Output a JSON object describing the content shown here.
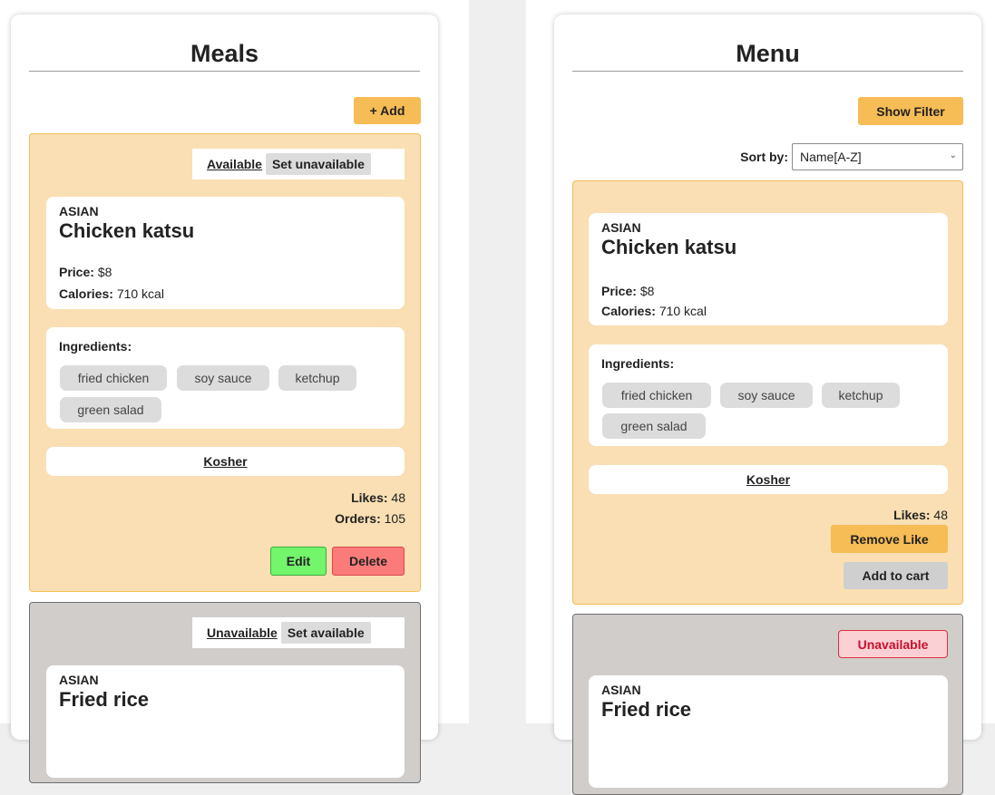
{
  "left": {
    "title": "Meals",
    "add_label": "+ Add",
    "meal1": {
      "status": "Available",
      "toggle_label": "Set unavailable",
      "cuisine": "ASIAN",
      "name": "Chicken katsu",
      "price_label": "Price:",
      "price": "$8",
      "calories_label": "Calories:",
      "calories": "710 kcal",
      "ingredients_label": "Ingredients:",
      "ingredients": [
        "fried chicken",
        "soy sauce",
        "ketchup",
        "green salad"
      ],
      "diet": "Kosher",
      "likes_label": "Likes:",
      "likes": "48",
      "orders_label": "Orders:",
      "orders": "105",
      "edit_label": "Edit",
      "delete_label": "Delete"
    },
    "meal2": {
      "status": "Unavailable",
      "toggle_label": "Set available",
      "cuisine": "ASIAN",
      "name": "Fried rice"
    }
  },
  "right": {
    "title": "Menu",
    "show_filter_label": "Show Filter",
    "sort_label": "Sort by:",
    "sort_value": "Name[A-Z]",
    "meal1": {
      "cuisine": "ASIAN",
      "name": "Chicken katsu",
      "price_label": "Price:",
      "price": "$8",
      "calories_label": "Calories:",
      "calories": "710 kcal",
      "ingredients_label": "Ingredients:",
      "ingredients": [
        "fried chicken",
        "soy sauce",
        "ketchup",
        "green salad"
      ],
      "diet": "Kosher",
      "likes_label": "Likes:",
      "likes": "48",
      "remove_like_label": "Remove Like",
      "add_to_cart_label": "Add to cart"
    },
    "meal2": {
      "status_badge": "Unavailable",
      "cuisine": "ASIAN",
      "name": "Fried rice"
    }
  },
  "colors": {
    "accent_orange": "#f6bc55",
    "card_orange": "#f9dfb3",
    "card_gray": "#d0cdcb",
    "edit_green": "#73f56c",
    "delete_red": "#fb7b7b",
    "unavailable_badge": "#fbd0d4"
  }
}
